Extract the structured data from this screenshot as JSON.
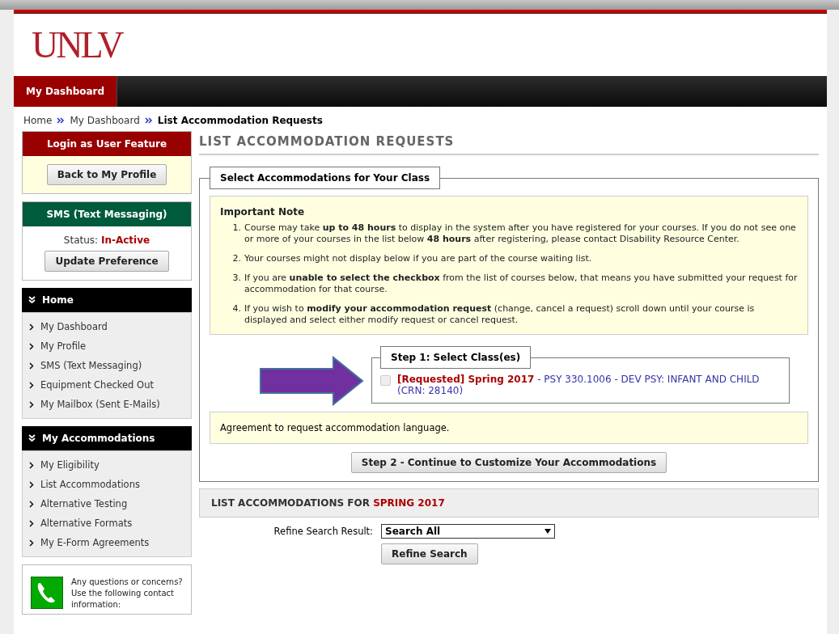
{
  "logo": "UNLV",
  "nav": [
    {
      "label": "My Dashboard",
      "selected": true
    }
  ],
  "breadcrumb": [
    {
      "label": "Home",
      "current": false
    },
    {
      "label": "My Dashboard",
      "current": false
    },
    {
      "label": "List Accommodation Requests",
      "current": true
    }
  ],
  "sidebar": {
    "login_panel": {
      "title": "Login as User Feature",
      "button": "Back to My Profile"
    },
    "sms_panel": {
      "title": "SMS (Text Messaging)",
      "status": "Status: **In-Active**",
      "button": "Update Preference"
    },
    "menus": [
      {
        "title": "Home",
        "items": [
          "My Dashboard",
          "My Profile",
          "SMS (Text Messaging)",
          "Equipment Checked Out",
          "My Mailbox (Sent E-Mails)"
        ]
      },
      {
        "title": "My Accommodations",
        "items": [
          "My Eligibility",
          "List Accommodations",
          "Alternative Testing",
          "Alternative Formats",
          "My E-Form Agreements"
        ]
      }
    ],
    "contact": {
      "text": "Any questions or concerns? Use the following contact information:"
    }
  },
  "page_title": "LIST ACCOMMODATION REQUESTS",
  "form": {
    "legend": "Select Accommodations for Your Class",
    "note": {
      "title": "Important Note",
      "items": [
        {
          "marker": "1.",
          "text": "Course may take **up to 48 hours** to display in the system after you have registered for your courses. If you do not see one or more of your courses in the list below **48 hours** after registering, please contact Disability Resource Center."
        },
        {
          "marker": "2.",
          "text": "Your courses might not display below if you are part of the course waiting list."
        },
        {
          "marker": "3.",
          "text": "If you are **unable to select the checkbox** from the list of courses below, that means you have submitted your request for accommodation for that course."
        },
        {
          "marker": "4.",
          "text": "If you wish to **modify your accommodation request** (change, cancel a request) scroll down until your course is displayed and select either modify request or cancel request."
        }
      ]
    },
    "step1": {
      "legend": "Step 1: Select Class(es)",
      "classes": [
        {
          "label": "**[Requested] Spring 2017** - PSY 330.1006 - DEV PSY: INFANT AND CHILD (CRN: 28140)",
          "checked": false,
          "disabled": true
        }
      ]
    },
    "agreement": "Agreement to request accommodation language.",
    "step2_button": "Step 2 - Continue to Customize Your Accommodations"
  },
  "list_section": {
    "title": "LIST ACCOMMODATIONS FOR **SPRING 2017**",
    "refine_label": "Refine Search Result:",
    "refine_value": "Search All",
    "refine_button": "Refine Search"
  }
}
